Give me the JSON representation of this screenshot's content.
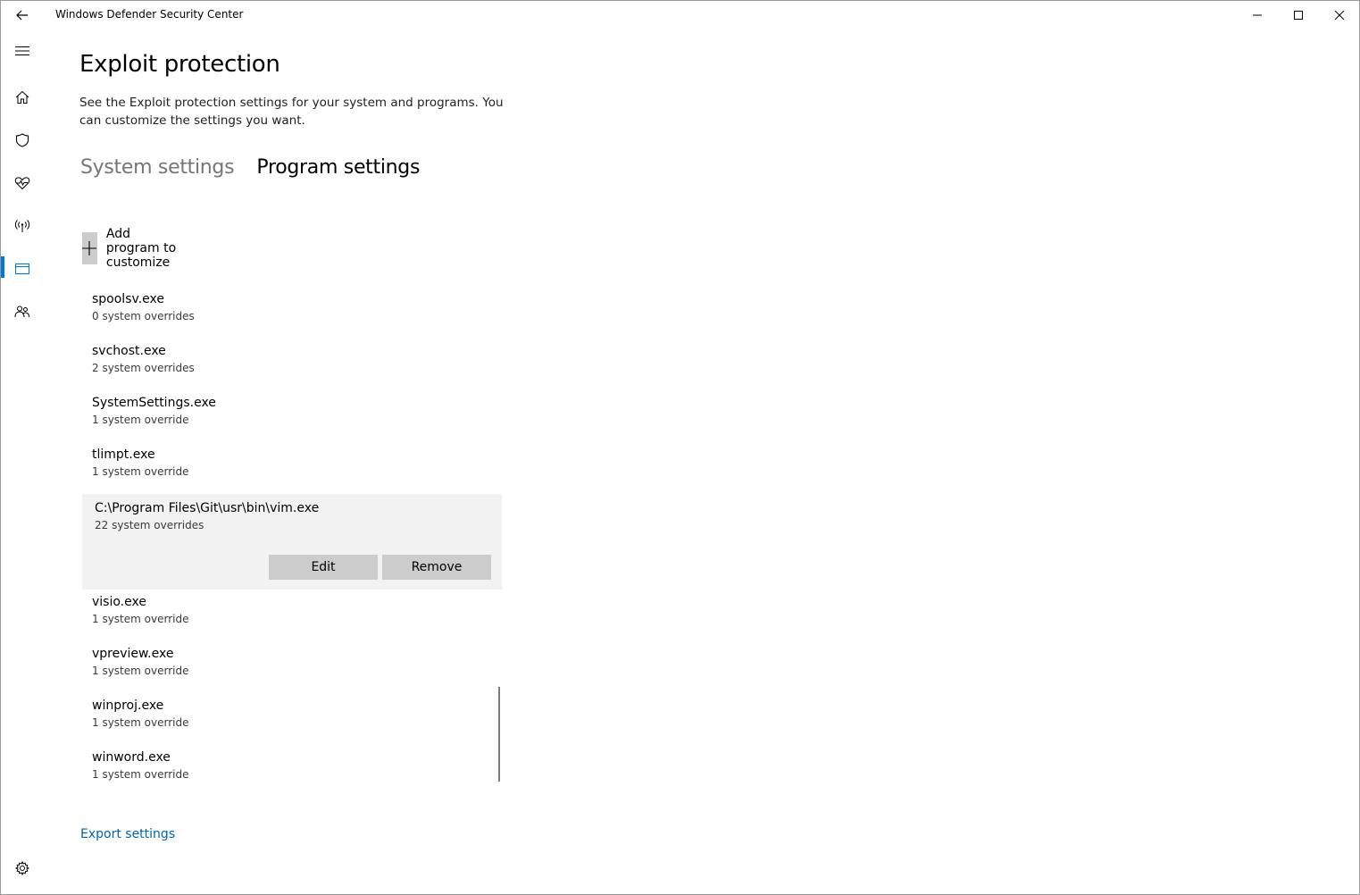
{
  "window": {
    "title": "Windows Defender Security Center"
  },
  "icons": {
    "back": "back-arrow-icon",
    "minimize": "minimize-icon",
    "maximize": "maximize-icon",
    "close": "close-icon",
    "menu": "hamburger-icon",
    "home": "home-icon",
    "virus": "shield-icon",
    "health": "heart-pulse-icon",
    "firewall": "wireless-antenna-icon",
    "appbrowser": "browser-window-icon",
    "family": "family-icon",
    "settings": "gear-icon",
    "add": "plus-icon"
  },
  "colors": {
    "accent": "#0078d7",
    "link": "#0063b1",
    "button_bg": "#cccccc",
    "selected_row_bg": "#f2f2f2",
    "inactive_tab": "#767676"
  },
  "page": {
    "title": "Exploit protection",
    "description": "See the Exploit protection settings for your system and programs.  You can customize the settings you want.",
    "tabs": [
      {
        "label": "System settings",
        "selected": false
      },
      {
        "label": "Program settings",
        "selected": true
      }
    ],
    "add_program_label": "Add program to customize",
    "export_label": "Export settings"
  },
  "programs": [
    {
      "name": "spoolsv.exe",
      "overrides": "0 system overrides"
    },
    {
      "name": "svchost.exe",
      "overrides": "2 system overrides"
    },
    {
      "name": "SystemSettings.exe",
      "overrides": "1 system override"
    },
    {
      "name": "tlimpt.exe",
      "overrides": "1 system override"
    },
    {
      "name": "C:\\Program Files\\Git\\usr\\bin\\vim.exe",
      "overrides": "22 system overrides",
      "expanded": true,
      "edit_label": "Edit",
      "remove_label": "Remove"
    },
    {
      "name": "visio.exe",
      "overrides": "1 system override"
    },
    {
      "name": "vpreview.exe",
      "overrides": "1 system override"
    },
    {
      "name": "winproj.exe",
      "overrides": "1 system override"
    },
    {
      "name": "winword.exe",
      "overrides": "1 system override"
    }
  ]
}
